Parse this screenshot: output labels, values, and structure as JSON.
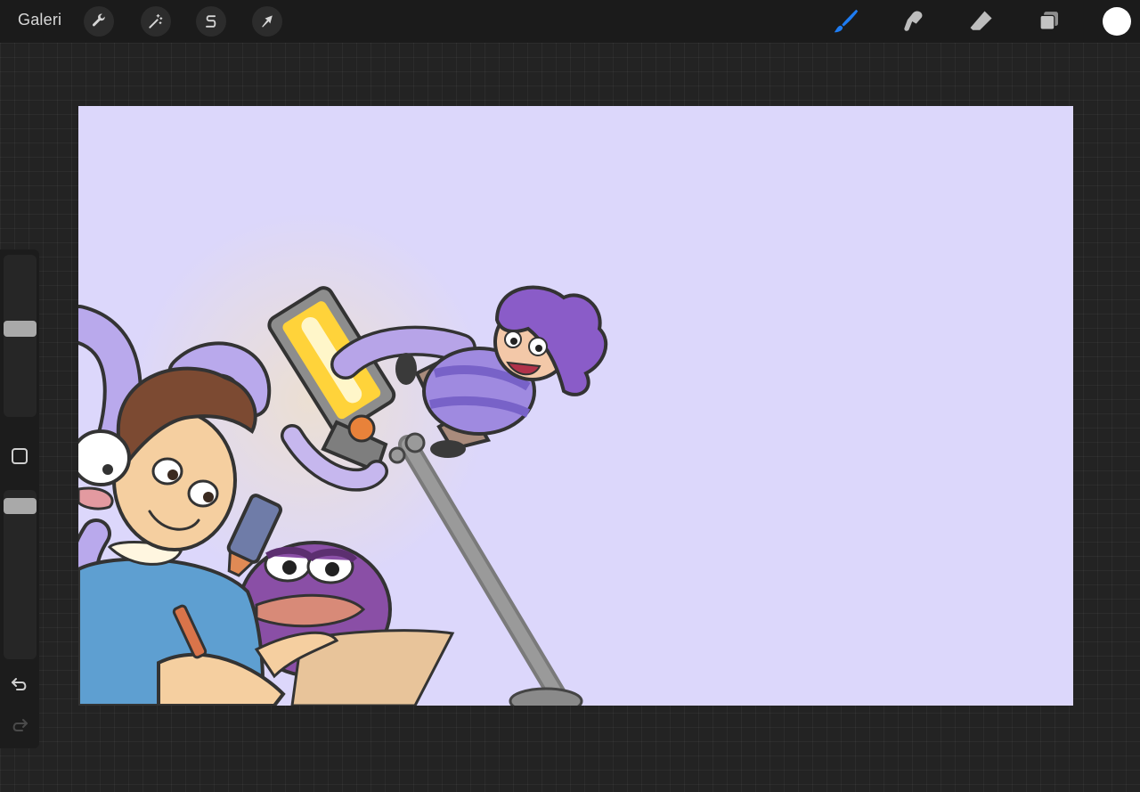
{
  "topbar": {
    "gallery_label": "Galeri",
    "left_tools": [
      {
        "name": "actions",
        "icon": "wrench-icon"
      },
      {
        "name": "adjustments",
        "icon": "magic-wand-icon"
      },
      {
        "name": "selection",
        "icon": "selection-s-icon"
      },
      {
        "name": "transform",
        "icon": "arrow-cursor-icon"
      }
    ],
    "right_tools": [
      {
        "name": "brush",
        "icon": "brush-icon",
        "active": true
      },
      {
        "name": "smudge",
        "icon": "smudge-icon"
      },
      {
        "name": "eraser",
        "icon": "eraser-icon"
      },
      {
        "name": "layers",
        "icon": "layers-icon"
      }
    ],
    "current_color": "#ffffff",
    "accent_color": "#1e7cf2"
  },
  "sidebar": {
    "brush_size": 0.55,
    "brush_opacity": 0.95
  },
  "canvas": {
    "background_color": "#dcd7fb",
    "content": "illustration"
  }
}
